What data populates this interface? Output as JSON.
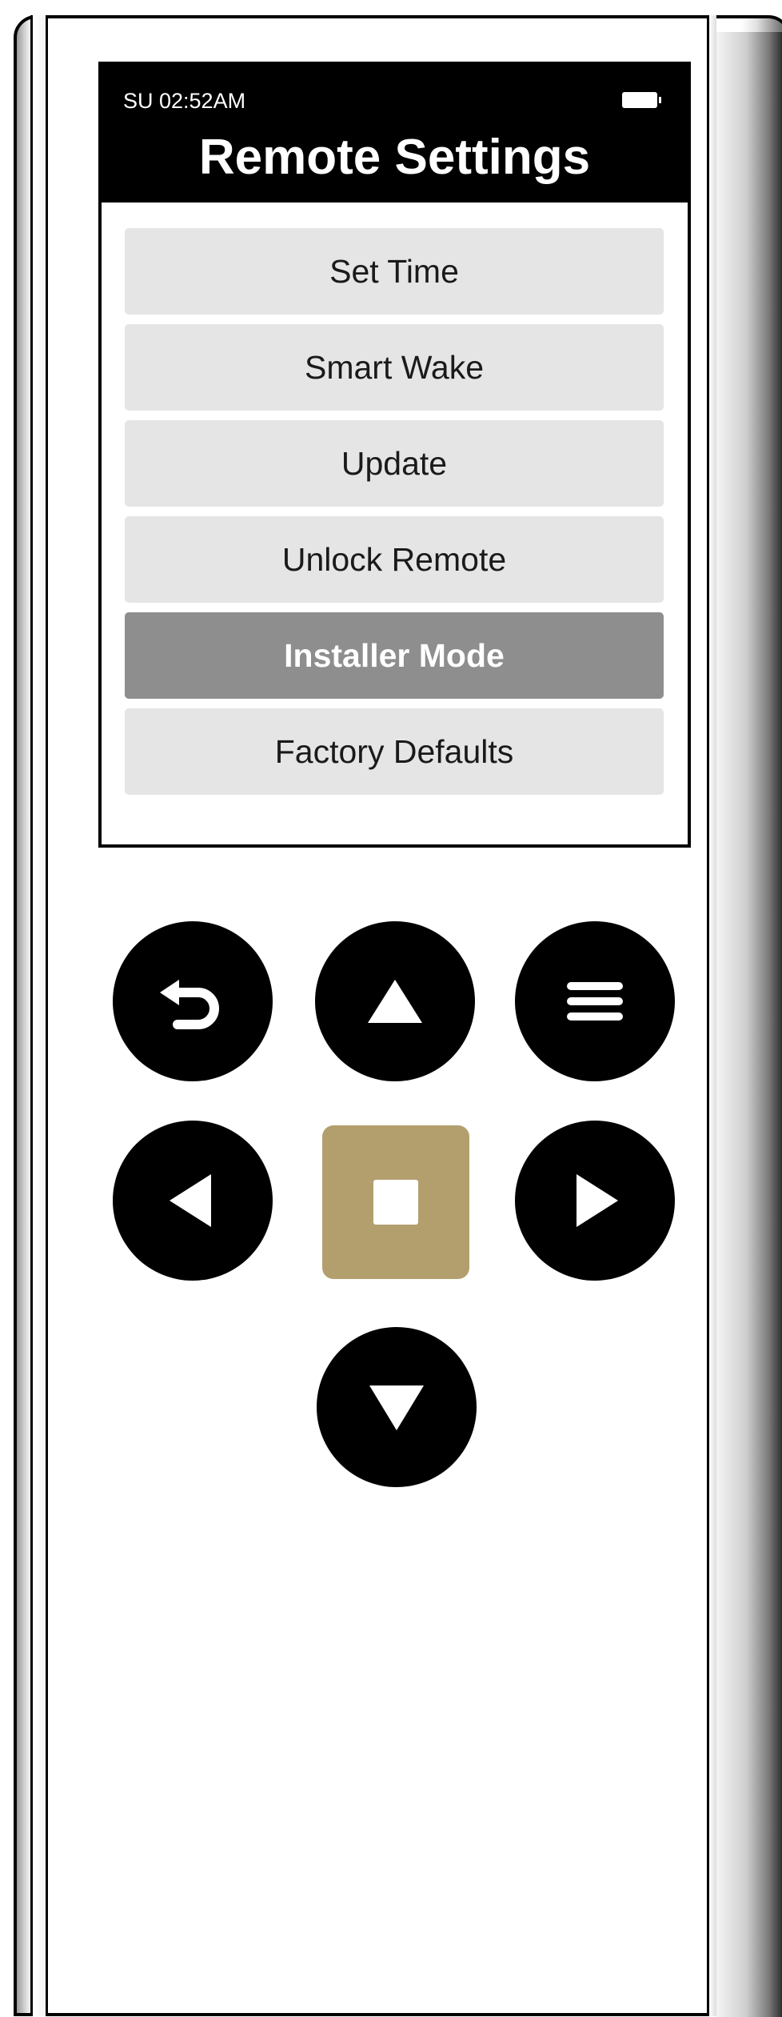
{
  "status": {
    "time": "SU 02:52AM",
    "battery_icon": "battery-icon"
  },
  "screen": {
    "title": "Remote Settings"
  },
  "menu": {
    "items": [
      {
        "label": "Set Time",
        "selected": false
      },
      {
        "label": "Smart Wake",
        "selected": false
      },
      {
        "label": "Update",
        "selected": false
      },
      {
        "label": "Unlock Remote",
        "selected": false
      },
      {
        "label": "Installer Mode",
        "selected": true
      },
      {
        "label": "Factory Defaults",
        "selected": false
      }
    ]
  },
  "buttons": {
    "back": "back-arrow-icon",
    "up": "triangle-up-icon",
    "menu": "hamburger-menu-icon",
    "left": "triangle-left-icon",
    "ok": "stop-square-icon",
    "right": "triangle-right-icon",
    "down": "triangle-down-icon"
  },
  "colors": {
    "header_bg": "#000000",
    "item_bg": "#e5e5e5",
    "item_selected_bg": "#8e8e8e",
    "ok_button": "#b39f6e"
  }
}
